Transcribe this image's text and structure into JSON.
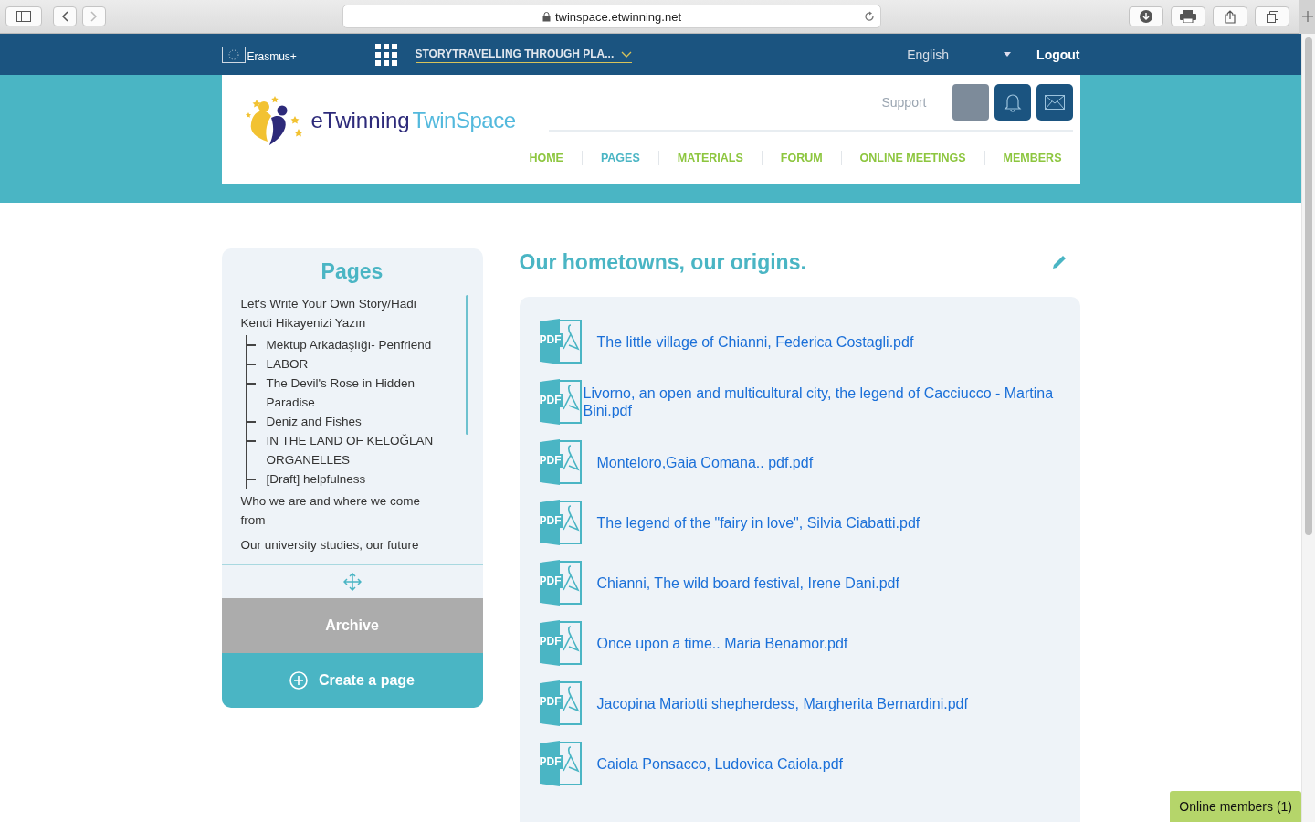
{
  "browser": {
    "url": "twinspace.etwinning.net"
  },
  "topbar": {
    "brand": "Erasmus+",
    "project": "STORYTRAVELLING THROUGH PLA...",
    "language": "English",
    "logout": "Logout"
  },
  "header": {
    "logo_part1": "eTwinning",
    "logo_part2": "TwinSpace",
    "support": "Support",
    "nav": [
      {
        "label": "HOME",
        "selected": false
      },
      {
        "label": "PAGES",
        "selected": true
      },
      {
        "label": "MATERIALS",
        "selected": false
      },
      {
        "label": "FORUM",
        "selected": false
      },
      {
        "label": "ONLINE MEETINGS",
        "selected": false
      },
      {
        "label": "MEMBERS",
        "selected": false
      }
    ]
  },
  "sidebar": {
    "title": "Pages",
    "pages": [
      {
        "label": "Let's Write Your Own Story/Hadi Kendi Hikayenizi Yazın",
        "children": [
          {
            "label": "Mektup Arkadaşlığı- Penfriend"
          },
          {
            "label": "LABOR"
          },
          {
            "label": "The Devil's Rose in Hidden Paradise"
          },
          {
            "label": "Deniz and Fishes"
          },
          {
            "label": "IN THE LAND OF KELOĞLAN ORGANELLES"
          },
          {
            "label": "[Draft] helpfulness"
          }
        ]
      },
      {
        "label": "Who we are and where we come from"
      },
      {
        "label": "Our university studies, our future"
      }
    ],
    "archive": "Archive",
    "create": "Create a page"
  },
  "main": {
    "title": "Our hometowns, our origins.",
    "files": [
      {
        "icon_label": "PDF",
        "name": "The little village of Chianni, Federica Costagli.pdf"
      },
      {
        "icon_label": "PDF",
        "name": "Livorno, an open and multicultural city, the legend of Cacciucco - Martina Bini.pdf"
      },
      {
        "icon_label": "PDF",
        "name": "Monteloro,Gaia Comana.. pdf.pdf"
      },
      {
        "icon_label": "PDF",
        "name": "The legend of the \"fairy in love\", Silvia Ciabatti.pdf"
      },
      {
        "icon_label": "PDF",
        "name": "Chianni, The wild board festival, Irene Dani.pdf"
      },
      {
        "icon_label": "PDF",
        "name": "Once upon a time.. Maria Benamor.pdf"
      },
      {
        "icon_label": "PDF",
        "name": "Jacopina Mariotti shepherdess, Margherita Bernardini.pdf"
      },
      {
        "icon_label": "PDF",
        "name": "Caiola Ponsacco, Ludovica Caiola.pdf"
      }
    ]
  },
  "online_members": "Online members (1)"
}
